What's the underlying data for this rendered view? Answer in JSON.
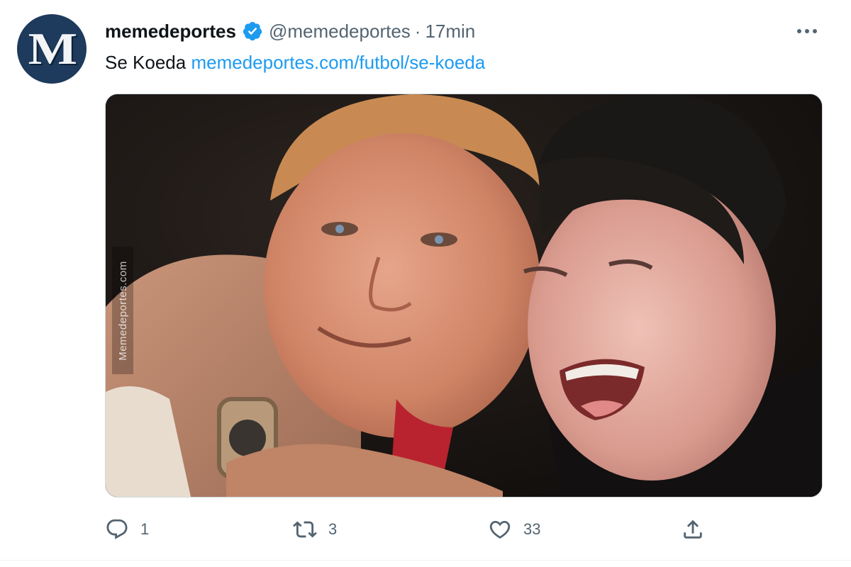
{
  "tweet": {
    "account": {
      "display_name": "memedeportes",
      "handle": "@memedeportes",
      "verified": true,
      "avatar_letter": "M",
      "avatar_color": "#1e3a5c"
    },
    "separator": "·",
    "timestamp": "17min",
    "text": "Se Koeda",
    "link_text": "memedeportes.com/futbol/se-koeda",
    "media": {
      "watermark": "Memedeportes.com"
    },
    "actions": {
      "reply_count": "1",
      "retweet_count": "3",
      "like_count": "33"
    },
    "colors": {
      "link": "#1d9bf0",
      "verified": "#1d9bf0",
      "muted": "#536471"
    }
  }
}
